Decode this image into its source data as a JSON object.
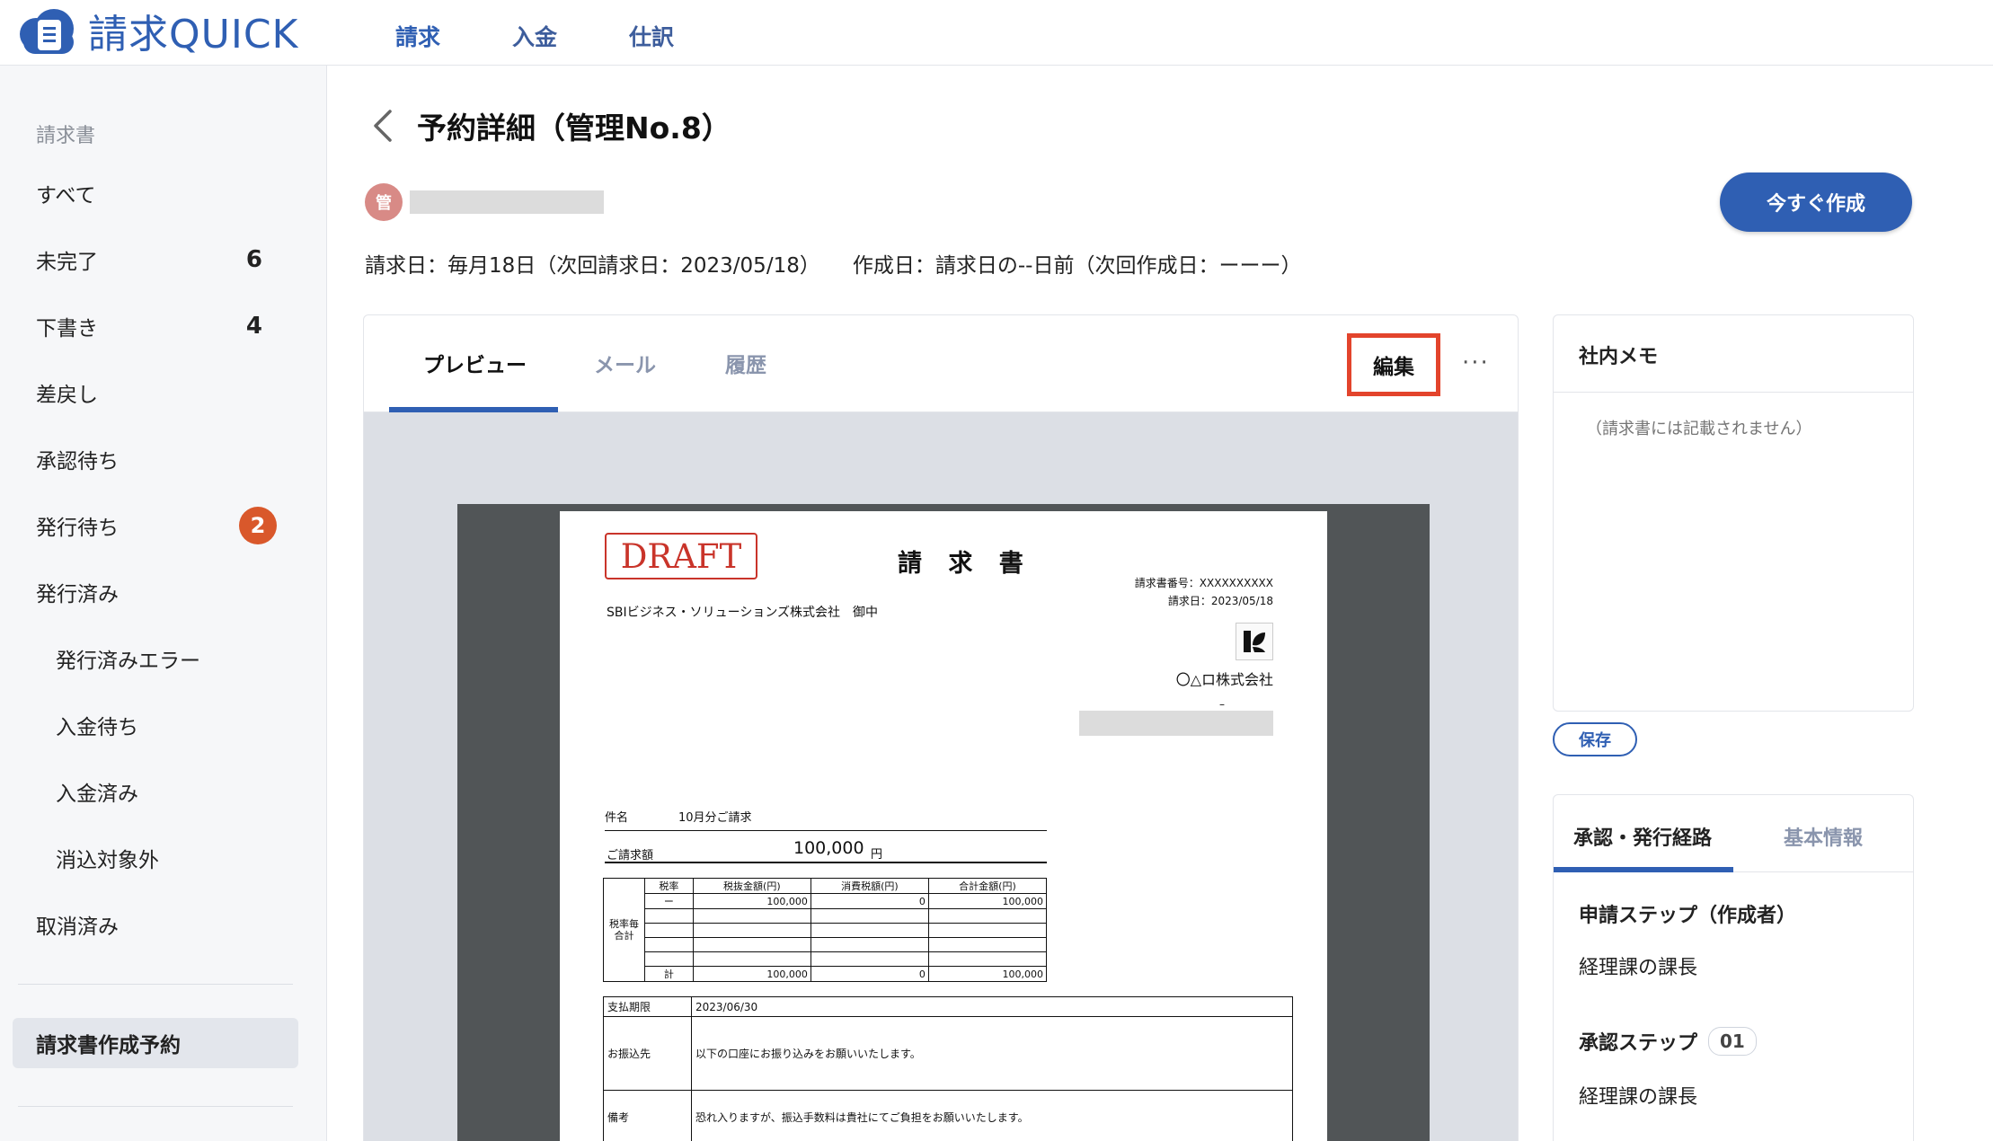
{
  "app": {
    "logo_text": "請求QUICK"
  },
  "topnav": [
    {
      "label": "請求",
      "active": true
    },
    {
      "label": "入金",
      "active": false
    },
    {
      "label": "仕訳",
      "active": false
    }
  ],
  "sidebar": {
    "heading": "請求書",
    "items": [
      {
        "label": "すべて",
        "count": ""
      },
      {
        "label": "未完了",
        "count": "6"
      },
      {
        "label": "下書き",
        "count": "4"
      },
      {
        "label": "差戻し",
        "count": ""
      },
      {
        "label": "承認待ち",
        "count": ""
      },
      {
        "label": "発行待ち",
        "badge": "2"
      },
      {
        "label": "発行済み",
        "count": ""
      },
      {
        "label": "発行済みエラー",
        "sub": true
      },
      {
        "label": "入金待ち",
        "sub": true
      },
      {
        "label": "入金済み",
        "sub": true
      },
      {
        "label": "消込対象外",
        "sub": true
      },
      {
        "label": "取消済み",
        "count": ""
      }
    ],
    "selected_item": "請求書作成予約"
  },
  "page": {
    "title": "予約詳細（管理No.8）",
    "avatar_initial": "管",
    "billing_date": "請求日：毎月18日（次回請求日：2023/05/18）",
    "creation_date": "作成日：請求日の--日前（次回作成日：ーーー）",
    "create_now_label": "今すぐ作成"
  },
  "preview": {
    "tabs": [
      "プレビュー",
      "メール",
      "履歴"
    ],
    "active_tab": "プレビュー",
    "edit_label": "編集",
    "more_label": "···"
  },
  "invoice": {
    "draft_stamp": "DRAFT",
    "title": "請 求 書",
    "invoice_no": "請求書番号：XXXXXXXXXX",
    "invoice_date": "請求日：2023/05/18",
    "client": "SBIビジネス・ソリューションズ株式会社　御中",
    "company": "〇△ロ株式会社",
    "dash": "–",
    "subject_label": "件名",
    "subject_value": "10月分ご請求",
    "amount_label": "ご請求額",
    "amount_value": "100,000",
    "amount_unit": "円",
    "tax_table": {
      "side_label_1": "税率毎",
      "side_label_2": "合計",
      "headers": [
        "税率",
        "税抜金額(円)",
        "消費税額(円)",
        "合計金額(円)"
      ],
      "rows": [
        [
          "ー",
          "100,000",
          "0",
          "100,000"
        ]
      ],
      "total": [
        "計",
        "100,000",
        "0",
        "100,000"
      ]
    },
    "payment": {
      "due_label": "支払期限",
      "due_value": "2023/06/30",
      "bank_label": "お振込先",
      "bank_value": "以下の口座にお振り込みをお願いいたします。",
      "note_label": "備考",
      "note_value": "恐れ入りますが、振込手数料は貴社にてご負担をお願いいたします。"
    }
  },
  "memo": {
    "title": "社内メモ",
    "placeholder": "（請求書には記載されません）",
    "save_label": "保存"
  },
  "flow": {
    "tabs": [
      "承認・発行経路",
      "基本情報"
    ],
    "active_tab": "承認・発行経路",
    "steps": [
      {
        "title": "申請ステップ（作成者）",
        "num": "",
        "person": "経理課の課長"
      },
      {
        "title": "承認ステップ",
        "num": "01",
        "person": "経理課の課長"
      }
    ]
  }
}
